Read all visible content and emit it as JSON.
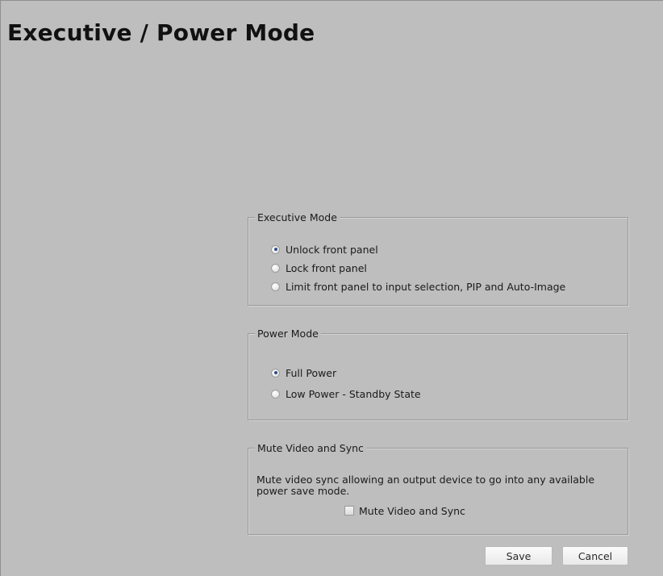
{
  "page": {
    "title": "Executive / Power Mode"
  },
  "executive_mode": {
    "legend": "Executive Mode",
    "options": [
      {
        "label": "Unlock front panel",
        "checked": true
      },
      {
        "label": "Lock front panel",
        "checked": false
      },
      {
        "label": "Limit front panel to input selection, PIP and Auto-Image",
        "checked": false
      }
    ]
  },
  "power_mode": {
    "legend": "Power Mode",
    "options": [
      {
        "label": "Full Power",
        "checked": true
      },
      {
        "label": "Low Power - Standby State",
        "checked": false
      }
    ]
  },
  "mute_video_sync": {
    "legend": "Mute Video and Sync",
    "description": "Mute video sync allowing an output device to go into any available power save mode.",
    "checkbox_label": "Mute Video and Sync",
    "checked": false
  },
  "actions": {
    "save_label": "Save",
    "cancel_label": "Cancel"
  },
  "colors": {
    "background": "#bebebe",
    "radio_dot": "#2d4e84"
  }
}
